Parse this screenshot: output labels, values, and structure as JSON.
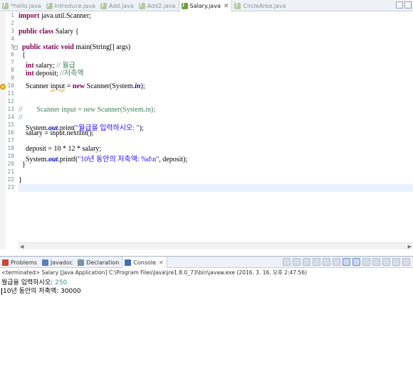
{
  "editor_tabs": [
    {
      "label": "*hello.java"
    },
    {
      "label": "Introduce.java"
    },
    {
      "label": "Add.java"
    },
    {
      "label": "Add2.java"
    },
    {
      "label": "Salary.java",
      "close": "✕"
    },
    {
      "label": "CircleArea.java"
    }
  ],
  "line_numbers": [
    "1",
    "2",
    "3",
    "4",
    "5",
    "6",
    "7",
    "8",
    "9",
    "10",
    "11",
    "12",
    "13",
    "14",
    "15",
    "16",
    "17",
    "18",
    "19",
    "20",
    "21",
    "22",
    "23"
  ],
  "code": {
    "l1_kw": "import",
    "l1_rest": " java.util.Scanner;",
    "l3_kw": "public class",
    "l3_rest": " Salary {",
    "l5_kw": "public static void",
    "l5_rest": " main(String[] args)",
    "l6": "{",
    "l7_kw": "int",
    "l7_var": " salary;",
    "l7_cm": " // 월급",
    "l8_kw": "int",
    "l8_var": " deposit;",
    "l8_cm": " //저축액",
    "l10_a": "Scanner ",
    "l10_var": "input",
    "l10_b": " = ",
    "l10_kw": "new",
    "l10_c": " Scanner(System.",
    "l10_fld": "in",
    "l10_d": ");",
    "l13": "//        Scanner input = new Scanner(System.in);",
    "l14": "//",
    "l15_a": "System.",
    "l15_fld": "out",
    "l15_b": ".print(",
    "l15_st": "\"월급을 입력하시오: \"",
    "l15_c": ");",
    "l16": "salary = input.nextInt();",
    "l18": "deposit = 10 * 12 * salary;",
    "l19_a": "System.",
    "l19_fld": "out",
    "l19_b": ".printf(",
    "l19_st": "\"10년 동안의 저축액: %d\\n\"",
    "l19_c": ", deposit);",
    "l20": "}",
    "l22": "}"
  },
  "view_tabs": [
    {
      "label": "Problems",
      "icon": "problems-icon",
      "color": "#c74a3a"
    },
    {
      "label": "Javadoc",
      "icon": "javadoc-icon",
      "color": "#5b7fb8"
    },
    {
      "label": "Declaration",
      "icon": "declaration-icon",
      "color": "#7a8fa8"
    },
    {
      "label": "Console",
      "icon": "console-icon",
      "color": "#3d6fb8",
      "close": "✕"
    }
  ],
  "console": {
    "description": "<terminated> Salary [Java Application] C:\\Program Files\\Java\\jre1.8.0_73\\bin\\javaw.exe (2016. 3. 16. 오후 2:47:56)",
    "prompt": "월급을 입력하시오: ",
    "input_value": "250",
    "result": "10년 동안의 저축액: 30000"
  }
}
